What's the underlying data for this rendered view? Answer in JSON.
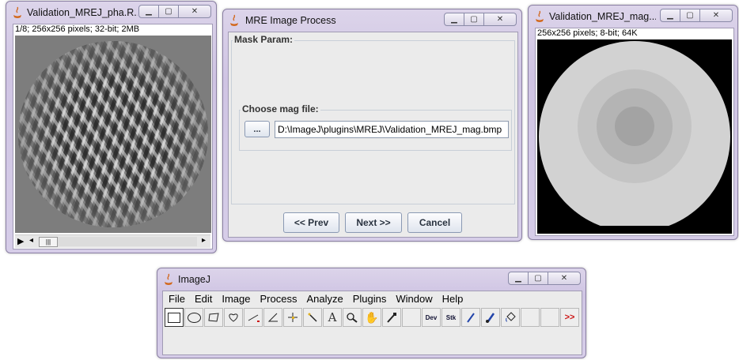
{
  "left_window": {
    "title": "Validation_MREJ_pha.R...",
    "info": "1/8; 256x256 pixels; 32-bit; 2MB",
    "scroll_thumb": "|||"
  },
  "mre_window": {
    "title": "MRE Image Process",
    "mask_param_label": "Mask Param:",
    "choose_mag_label": "Choose mag file:",
    "browse_label": "...",
    "path_value": "D:\\ImageJ\\plugins\\MREJ\\Validation_MREJ_mag.bmp",
    "prev_label": "<< Prev",
    "next_label": "Next >>",
    "cancel_label": "Cancel"
  },
  "right_window": {
    "title": "Validation_MREJ_mag....",
    "info": "256x256 pixels; 8-bit; 64K"
  },
  "imagej_window": {
    "title": "ImageJ",
    "menu": [
      "File",
      "Edit",
      "Image",
      "Process",
      "Analyze",
      "Plugins",
      "Window",
      "Help"
    ],
    "tools": {
      "dev_label": "Dev",
      "stk_label": "Stk",
      "more_label": ">>"
    }
  },
  "colors": {
    "accent_red": "#cc1111",
    "title_gradient": "#cfc4e3"
  }
}
